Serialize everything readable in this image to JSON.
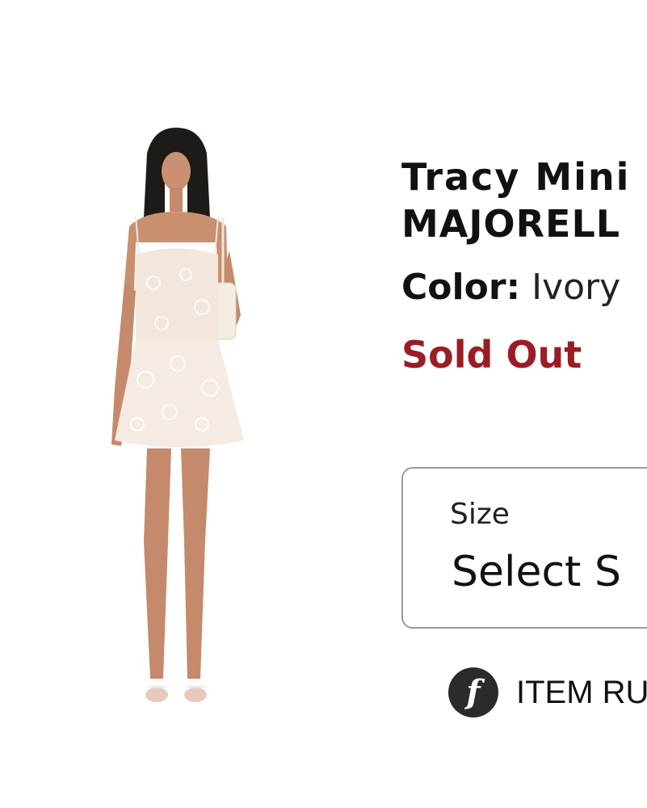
{
  "product": {
    "title": "Tracy Mini",
    "brand": "MAJORELL",
    "color_label": "Color:",
    "color_value": "Ivory",
    "availability": "Sold Out"
  },
  "size_selector": {
    "label": "Size",
    "value": "Select S"
  },
  "fit": {
    "icon_glyph": "f",
    "text": "ITEM RU"
  },
  "colors": {
    "sold_out": "#9b1d23",
    "border": "#9a9a9a",
    "icon_bg": "#2b2b2b"
  }
}
